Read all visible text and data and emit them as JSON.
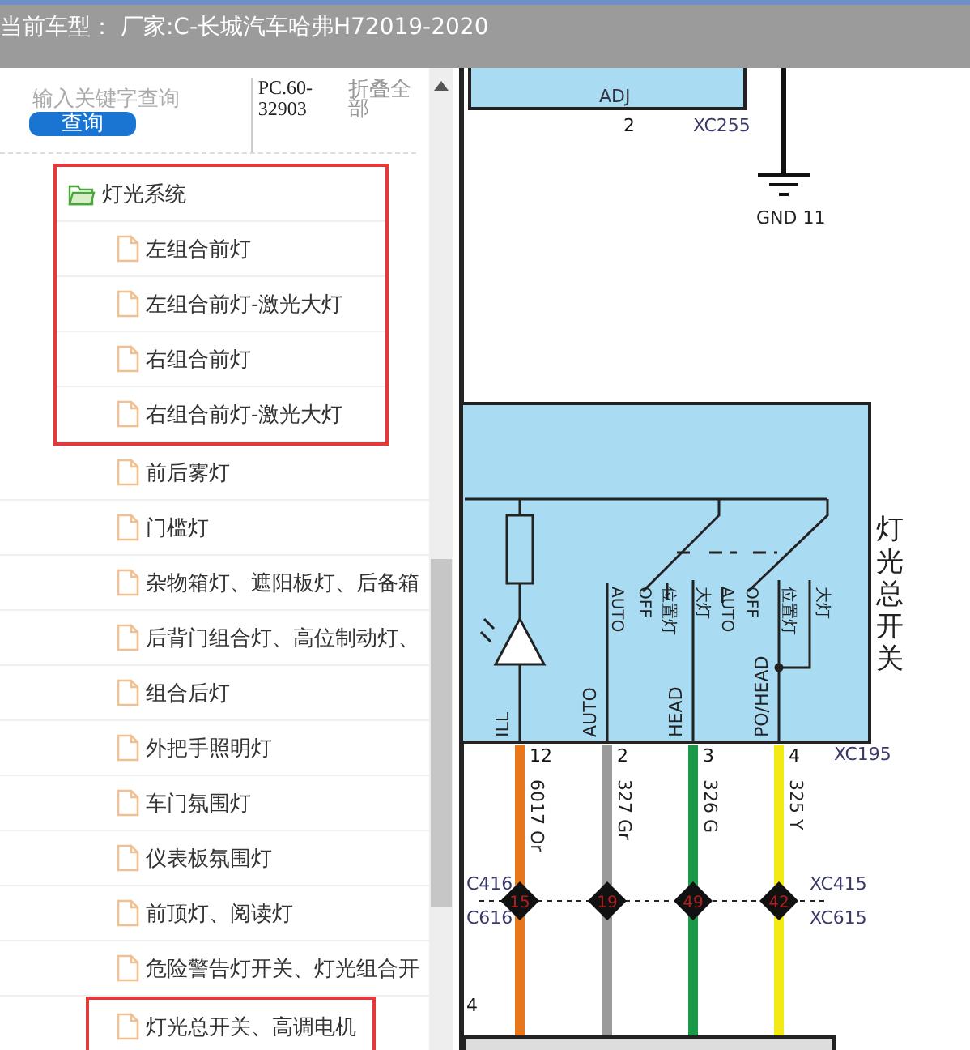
{
  "header": {
    "title": "当前车型：  厂家:C-长城汽车哈弗H72019-2020"
  },
  "search": {
    "placeholder": "输入关键字查询",
    "button": "查询",
    "code": "PC.60-32903",
    "collapse": "折叠全部"
  },
  "tree": [
    {
      "label": "灯光系统",
      "expanded": true,
      "boxed": true,
      "children": [
        {
          "label": "左组合前灯",
          "boxed": true
        },
        {
          "label": "左组合前灯-激光大灯",
          "boxed": true
        },
        {
          "label": "右组合前灯",
          "boxed": true
        },
        {
          "label": "右组合前灯-激光大灯",
          "boxed": true
        },
        {
          "label": "前后雾灯",
          "boxed": false
        },
        {
          "label": "门槛灯",
          "boxed": false
        },
        {
          "label": "杂物箱灯、遮阳板灯、后备箱",
          "boxed": false
        },
        {
          "label": "后背门组合灯、高位制动灯、",
          "boxed": false
        },
        {
          "label": "组合后灯",
          "boxed": false
        },
        {
          "label": "外把手照明灯",
          "boxed": false
        },
        {
          "label": "车门氛围灯",
          "boxed": false
        },
        {
          "label": "仪表板氛围灯",
          "boxed": false
        },
        {
          "label": "前顶灯、阅读灯",
          "boxed": false
        },
        {
          "label": "危险警告灯开关、灯光组合开",
          "boxed": false
        },
        {
          "label": "灯光总开关、高调电机",
          "boxed": true
        }
      ]
    }
  ],
  "diagram": {
    "top_connector": {
      "pin_label": "ADJ",
      "pin": "2",
      "connector": "XC255"
    },
    "ground": "GND 11",
    "switch": {
      "name": "灯光总开关",
      "terminals": [
        "ILL",
        "AUTO",
        "HEAD",
        "PO/HEAD"
      ],
      "positions": [
        "AUTO",
        "OFF",
        "位置灯",
        "大灯",
        "AUTO",
        "OFF",
        "位置灯",
        "大灯"
      ],
      "connector": "XC195"
    },
    "wires": [
      {
        "pin": "12",
        "label": "6017 Or",
        "color": "#e8761a",
        "joint": "15"
      },
      {
        "pin": "2",
        "label": "327 Gr",
        "color": "#9a9a9a",
        "joint": "19"
      },
      {
        "pin": "3",
        "label": "326 G",
        "color": "#1a9a48",
        "joint": "49"
      },
      {
        "pin": "4",
        "label": "325 Y",
        "color": "#f2ea12",
        "joint": "42"
      }
    ],
    "joint_connectors": {
      "left_top": "C416",
      "left_bottom": "C616",
      "right_top": "XC415",
      "right_bottom": "XC615"
    },
    "stray_pin": "4"
  }
}
